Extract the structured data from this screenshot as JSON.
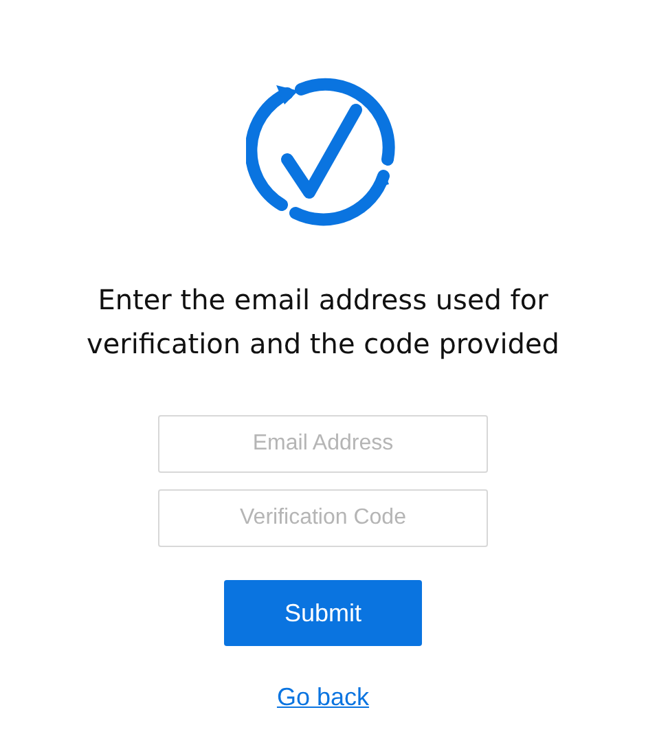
{
  "heading": "Enter the email address used for verification and the code provided",
  "fields": [
    {
      "placeholder": "Email Address"
    },
    {
      "placeholder": "Verification Code"
    }
  ],
  "submit": "Submit",
  "back_link": "Go back"
}
